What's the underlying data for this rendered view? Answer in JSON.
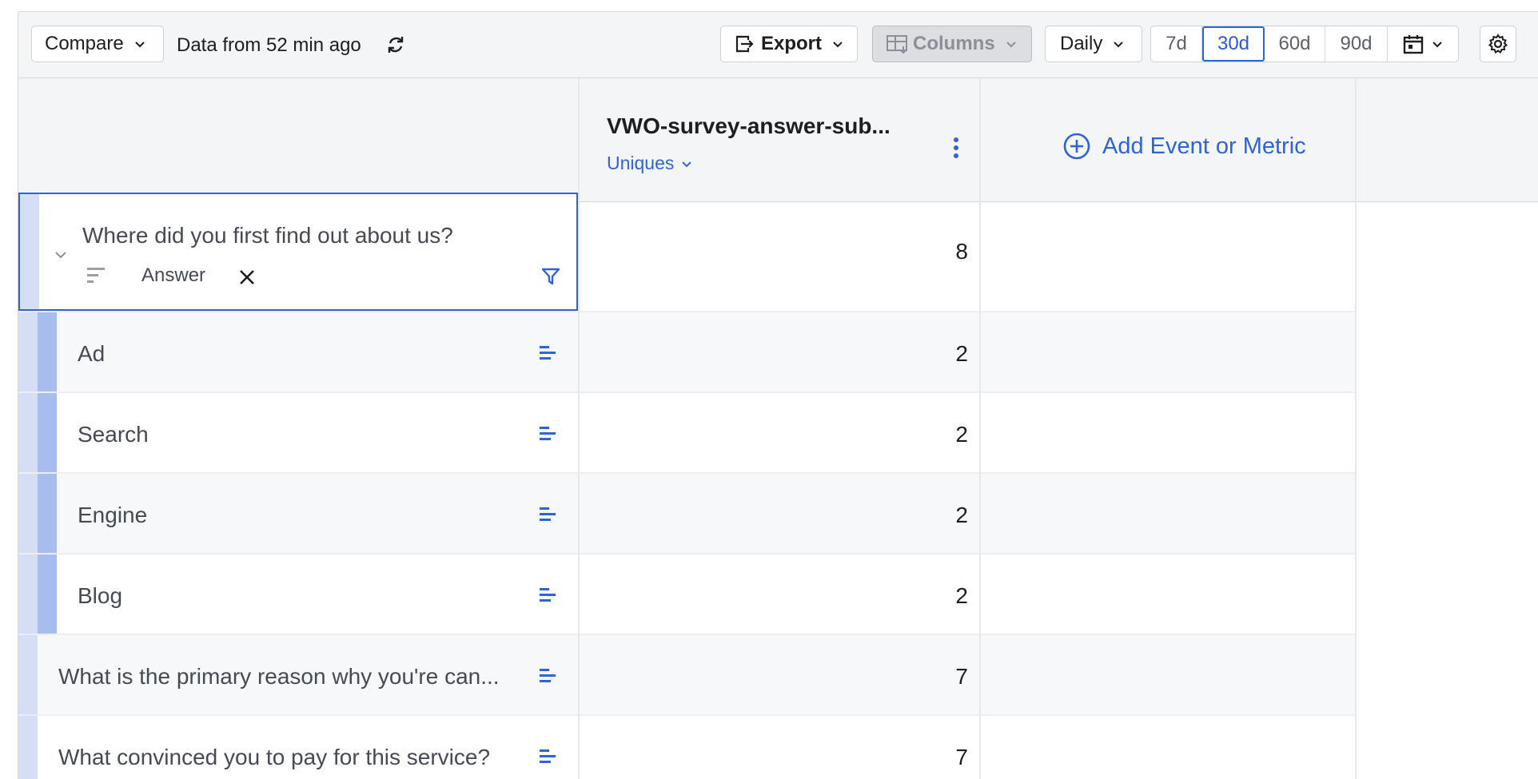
{
  "toolbar": {
    "compare_label": "Compare",
    "data_freshness": "Data from 52 min ago",
    "export_label": "Export",
    "columns_label": "Columns",
    "interval_label": "Daily",
    "ranges": [
      "7d",
      "30d",
      "60d",
      "90d"
    ],
    "active_range": "30d"
  },
  "header": {
    "metric_title": "VWO-survey-answer-sub...",
    "metric_type": "Uniques",
    "add_metric_label": "Add Event or Metric"
  },
  "rows": {
    "question1": {
      "label": "Where did you first find out about us?",
      "property": "Answer",
      "value": "8"
    },
    "answers": [
      {
        "label": "Ad",
        "value": "2"
      },
      {
        "label": "Search",
        "value": "2"
      },
      {
        "label": "Engine",
        "value": "2"
      },
      {
        "label": "Blog",
        "value": "2"
      }
    ],
    "question2": {
      "label": "What is the primary reason why you're can...",
      "value": "7"
    },
    "question3": {
      "label": "What convinced you to pay for this service?",
      "value": "7"
    }
  },
  "colors": {
    "accent": "#2f63da",
    "bar_dark": "#a7bdf0",
    "bar_light": "#d5def4"
  }
}
